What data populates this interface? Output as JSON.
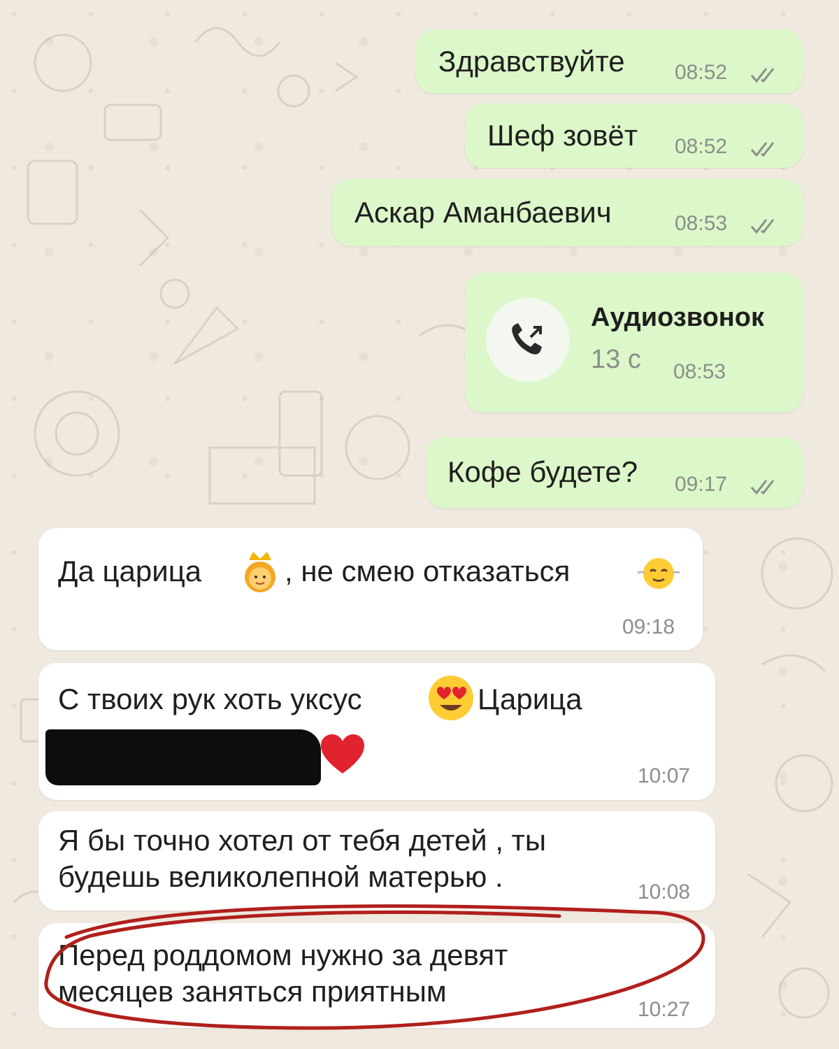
{
  "messages": [
    {
      "text": "Здравствуйте",
      "time": "08:52",
      "direction": "outgoing",
      "status": "read"
    },
    {
      "text": "Шеф зовёт",
      "time": "08:52",
      "direction": "outgoing",
      "status": "read"
    },
    {
      "text": "Аскар Аманбаевич",
      "time": "08:53",
      "direction": "outgoing",
      "status": "read"
    },
    {
      "call_title": "Аудиозвонок",
      "call_duration": "13 с",
      "time": "08:53",
      "direction": "outgoing",
      "icon": "outgoing-call-icon"
    },
    {
      "text": "Кофе будете?",
      "time": "09:17",
      "direction": "outgoing",
      "status": "read"
    },
    {
      "text_before_emoji": "Да царица",
      "emoji_1": "princess-emoji",
      "text_after_emoji": ", не смею отказаться",
      "emoji_2": "relieved-face-emoji",
      "time": "09:18",
      "direction": "incoming"
    },
    {
      "text_before_emoji": "С твоих рук хоть уксус",
      "emoji_1": "heart-eyes-emoji",
      "text_after_emoji": "Царица",
      "redacted": true,
      "emoji_2": "red-heart-emoji",
      "time": "10:07",
      "direction": "incoming"
    },
    {
      "line_1": "Я бы точно хотел от тебя детей , ты",
      "line_2": "будешь великолепной матерью .",
      "time": "10:08",
      "direction": "incoming"
    },
    {
      "line_1": "Перед роддомом нужно за девят",
      "line_2": "месяцев заняться приятным",
      "time": "10:27",
      "direction": "incoming",
      "highlighted": true
    }
  ],
  "colors": {
    "outgoing_bubble": "#dcf7c9",
    "incoming_bubble": "#ffffff",
    "wallpaper": "#efe9df",
    "read_ticks": "#8a8f8a",
    "highlight_marker": "#b0201c"
  }
}
